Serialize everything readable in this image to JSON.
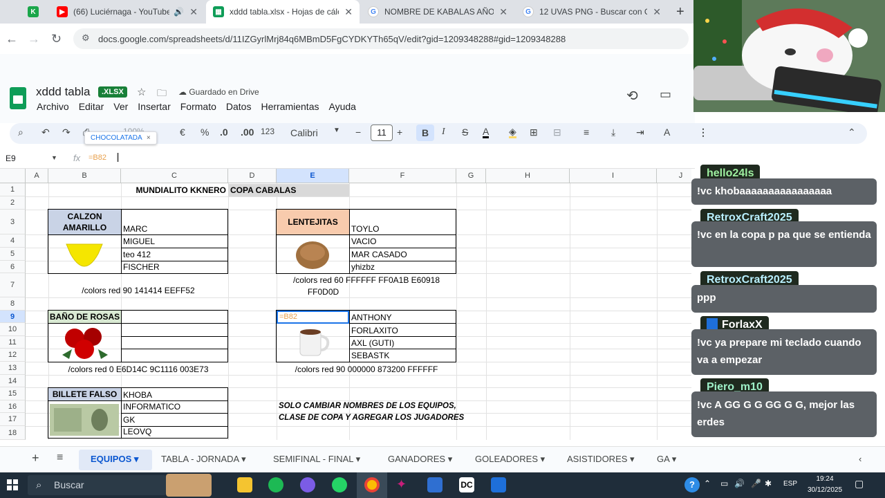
{
  "browser": {
    "tabs": [
      {
        "title": "(66) Luciérnaga - YouTube",
        "icon": "youtube-icon",
        "color": "#ff0000"
      },
      {
        "title": "xddd tabla.xlsx - Hojas de cálcu",
        "icon": "sheets-icon",
        "color": "#0f9d58"
      },
      {
        "title": "NOMBRE DE KABALAS AÑO NU",
        "icon": "google-icon",
        "color": "#4285f4"
      },
      {
        "title": "12 UVAS PNG - Buscar con Goo",
        "icon": "google-icon",
        "color": "#4285f4"
      }
    ],
    "url": "docs.google.com/spreadsheets/d/11IZGyrlMrj84q6MBmD5FgCYDKYTh65qV/edit?gid=1209348288#gid=1209348288"
  },
  "doc": {
    "title": "xddd tabla",
    "badge": ".XLSX",
    "saved": "Guardado en Drive",
    "menu": [
      "Archivo",
      "Editar",
      "Ver",
      "Insertar",
      "Formato",
      "Datos",
      "Herramientas",
      "Ayuda"
    ]
  },
  "toolbar": {
    "zoom": "100%",
    "currency": "€",
    "percent": "%",
    "dec_less": ".0",
    "dec_more": ".00",
    "number_format": "123",
    "font": "Calibri",
    "size": "11",
    "tooltip": "CHOCOLATADA"
  },
  "formula": {
    "namebox": "E9",
    "value": "=B82",
    "fx": "fx"
  },
  "grid": {
    "columns": [
      "A",
      "B",
      "C",
      "D",
      "E",
      "F",
      "G",
      "H",
      "I",
      "J"
    ],
    "rows": [
      "1",
      "2",
      "3",
      "4",
      "5",
      "6",
      "7",
      "8",
      "9",
      "10",
      "11",
      "12",
      "13",
      "14",
      "15",
      "16",
      "17",
      "18"
    ],
    "title1": "MUNDIALITO KKNERO",
    "title2": "COPA CABALAS",
    "team1": {
      "name1": "CALZON",
      "name2": "AMARILLO",
      "players": [
        "MARC",
        "MIGUEL",
        "teo 412",
        "FISCHER"
      ],
      "colors": "/colors red 90 141414 EEFF52"
    },
    "team2": {
      "name": "LENTEJITAS",
      "players": [
        "TOYLO",
        "VACIO",
        "MAR CASADO",
        "yhizbz"
      ],
      "colors1": "/colors red 60 FFFFFF FF0A1B E60918",
      "colors2": "FF0D0D"
    },
    "team3": {
      "name": "BAÑO DE ROSAS",
      "players": [
        "",
        "",
        "",
        ""
      ],
      "colors": "/colors red 0 E6D14C 9C1116 003E73"
    },
    "team4": {
      "name": "=B82",
      "players": [
        "ANTHONY",
        "FORLAXITO",
        "AXL (GUTI)",
        "SEBASTK"
      ],
      "colors": "/colors red 90 000000 873200 FFFFFF"
    },
    "team5": {
      "name": "BILLETE FALSO",
      "players": [
        "KHOBA",
        "INFORMATICO",
        "GK",
        "LEOVQ"
      ]
    },
    "note1": "SOLO CAMBIAR NOMBRES DE LOS EQUIPOS,",
    "note2": "CLASE DE COPA Y AGREGAR LOS JUGADORES"
  },
  "sheets": [
    "EQUIPOS",
    "TABLA - JORNADA",
    "SEMIFINAL - FINAL",
    "GANADORES",
    "GOLEADORES",
    "ASISTIDORES",
    "GA"
  ],
  "chat": [
    {
      "user": "hello24ls",
      "color": "#9ef0a0",
      "msg": "!vc khobaaaaaaaaaaaaaaaa"
    },
    {
      "user": "RetroxCraft2025",
      "color": "#b9f0ff",
      "msg": "!vc en la copa p pa que se entienda"
    },
    {
      "user": "RetroxCraft2025",
      "color": "#b9f0ff",
      "msg": "ppp"
    },
    {
      "user": "ForlaxX",
      "color": "#ffffff",
      "msg": "!vc ya prepare mi teclado cuando va a empezar"
    },
    {
      "user": "Piero_m10",
      "color": "#9ef0c8",
      "msg": "!vc A GG G G GG G G, mejor las erdes"
    }
  ],
  "taskbar": {
    "search": "Buscar",
    "time": "19:24",
    "date": "30/12/2025",
    "lang": "ESP"
  }
}
